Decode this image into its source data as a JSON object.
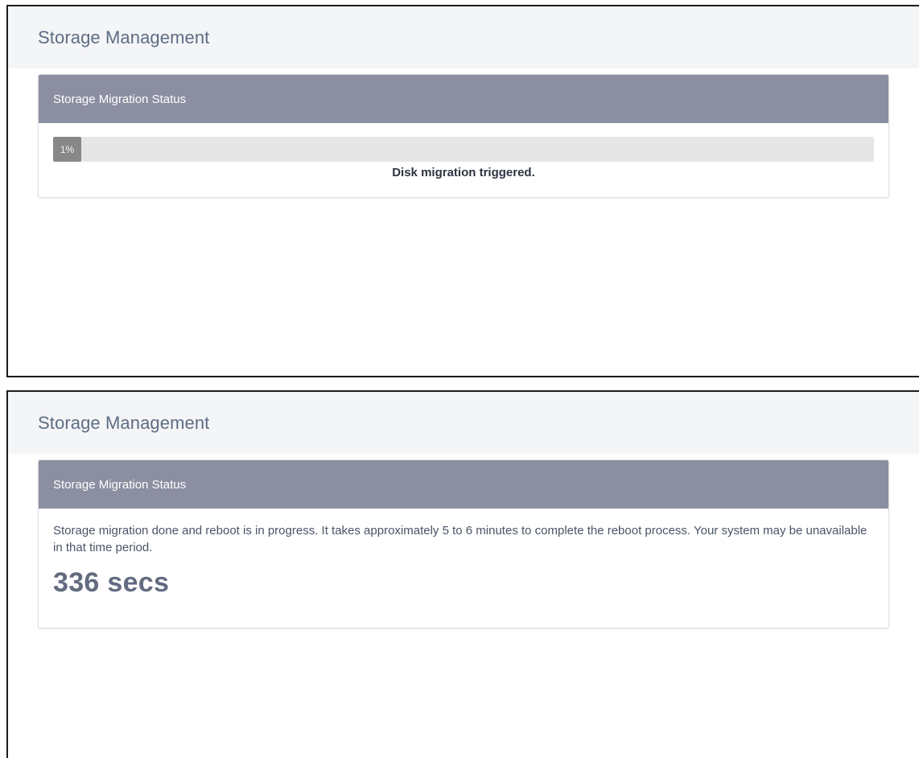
{
  "screen1": {
    "header": {
      "title": "Storage Management"
    },
    "panel": {
      "title": "Storage Migration Status",
      "progress": {
        "percent": 1,
        "label": "1%"
      },
      "status_text": "Disk migration triggered."
    }
  },
  "screen2": {
    "header": {
      "title": "Storage Management"
    },
    "panel": {
      "title": "Storage Migration Status",
      "message": "Storage migration done and reboot is in progress. It takes approximately 5 to 6 minutes to complete the reboot process. Your system may be unavailable in that time period.",
      "countdown": "336 secs"
    }
  },
  "colors": {
    "header_bg": "#f4f5f7",
    "panel_heading_bg": "#8b8fa1",
    "progress_fill": "#888888",
    "progress_track": "#e6e6e6",
    "title_text": "#5e6c84"
  }
}
